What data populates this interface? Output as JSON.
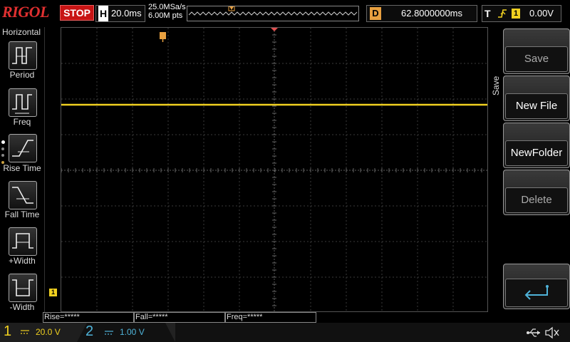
{
  "topbar": {
    "brand": "RIGOL",
    "run_state": "STOP",
    "horizontal_letter": "H",
    "timebase": "20.0ms",
    "sample_rate": "25.0MSa/s",
    "memory_depth": "6.00M pts",
    "delay_letter": "D",
    "delay": "62.8000000ms",
    "trigger_letter": "T",
    "trigger_source": "1",
    "trigger_level": "0.00V"
  },
  "left_panel": {
    "title": "Horizontal",
    "items": [
      "Period",
      "Freq",
      "Rise Time",
      "Fall Time",
      "+Width",
      "-Width"
    ]
  },
  "right_menu": {
    "title": "Save",
    "items": [
      "Save",
      "New File",
      "NewFolder",
      "Delete"
    ],
    "enter_icon": "enter-icon"
  },
  "measurements": [
    "Rise=*****",
    "Fall=*****",
    "Freq=*****"
  ],
  "channels": {
    "ch1": {
      "num": "1",
      "scale": "20.0 V"
    },
    "ch2": {
      "num": "2",
      "scale": "1.00 V"
    }
  },
  "markers": {
    "ch1_ground": "1"
  },
  "colors": {
    "ch1": "#f0d020",
    "ch2": "#4fb3d9",
    "stop": "#c81414",
    "trigger": "#e8a040"
  }
}
